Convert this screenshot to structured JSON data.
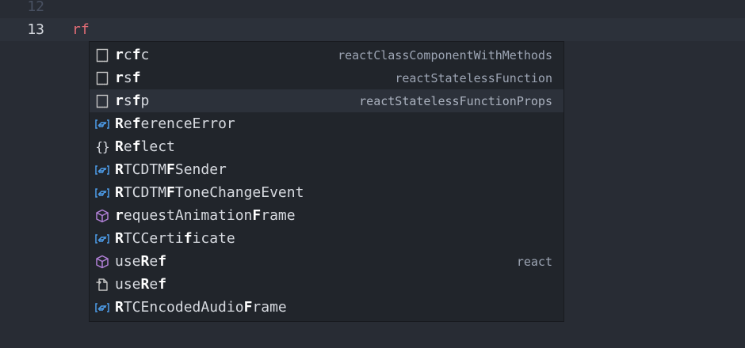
{
  "editor": {
    "lines": [
      {
        "number": "12",
        "text": ""
      },
      {
        "number": "13",
        "text": "rf"
      }
    ]
  },
  "suggestions": [
    {
      "icon": "snippet-icon",
      "parts": [
        [
          "r",
          1
        ],
        [
          "c",
          0
        ],
        [
          "f",
          1
        ],
        [
          "c",
          0
        ]
      ],
      "detail": "reactClassComponentWithMethods"
    },
    {
      "icon": "snippet-icon",
      "parts": [
        [
          "r",
          1
        ],
        [
          "s",
          0
        ],
        [
          "f",
          1
        ]
      ],
      "detail": "reactStatelessFunction"
    },
    {
      "icon": "snippet-icon",
      "parts": [
        [
          "r",
          1
        ],
        [
          "s",
          0
        ],
        [
          "f",
          1
        ],
        [
          "p",
          0
        ]
      ],
      "detail": "reactStatelessFunctionProps",
      "selected": true
    },
    {
      "icon": "variable-icon",
      "parts": [
        [
          "R",
          1
        ],
        [
          "e",
          0
        ],
        [
          "f",
          1
        ],
        [
          "erenceError",
          0
        ]
      ],
      "detail": ""
    },
    {
      "icon": "namespace-icon",
      "parts": [
        [
          "R",
          1
        ],
        [
          "e",
          0
        ],
        [
          "f",
          1
        ],
        [
          "lect",
          0
        ]
      ],
      "detail": ""
    },
    {
      "icon": "variable-icon",
      "parts": [
        [
          "R",
          1
        ],
        [
          "TCDTM",
          0
        ],
        [
          "F",
          1
        ],
        [
          "Sender",
          0
        ]
      ],
      "detail": ""
    },
    {
      "icon": "variable-icon",
      "parts": [
        [
          "R",
          1
        ],
        [
          "TCDTM",
          0
        ],
        [
          "F",
          1
        ],
        [
          "ToneChangeEvent",
          0
        ]
      ],
      "detail": ""
    },
    {
      "icon": "function-icon",
      "parts": [
        [
          "r",
          1
        ],
        [
          "equestAnimation",
          0
        ],
        [
          "F",
          1
        ],
        [
          "rame",
          0
        ]
      ],
      "detail": ""
    },
    {
      "icon": "variable-icon",
      "parts": [
        [
          "R",
          1
        ],
        [
          "TCCert",
          0
        ],
        [
          "i",
          0
        ],
        [
          "f",
          1
        ],
        [
          "icate",
          0
        ]
      ],
      "detail": ""
    },
    {
      "icon": "function-icon",
      "parts": [
        [
          "use",
          0
        ],
        [
          "R",
          1
        ],
        [
          "e",
          0
        ],
        [
          "f",
          1
        ]
      ],
      "detail": "react"
    },
    {
      "icon": "file-import-icon",
      "parts": [
        [
          "use",
          0
        ],
        [
          "R",
          1
        ],
        [
          "e",
          0
        ],
        [
          "f",
          1
        ]
      ],
      "detail": ""
    },
    {
      "icon": "variable-icon",
      "parts": [
        [
          "R",
          1
        ],
        [
          "TCEncodedAudio",
          0
        ],
        [
          "F",
          1
        ],
        [
          "rame",
          0
        ]
      ],
      "detail": ""
    }
  ],
  "colors": {
    "background": "#282c34",
    "current_line": "#2c313a",
    "typed_text": "#e06c75",
    "widget_background": "#21252b",
    "variable_icon": "#4d9ce8",
    "function_icon": "#b180d7"
  }
}
